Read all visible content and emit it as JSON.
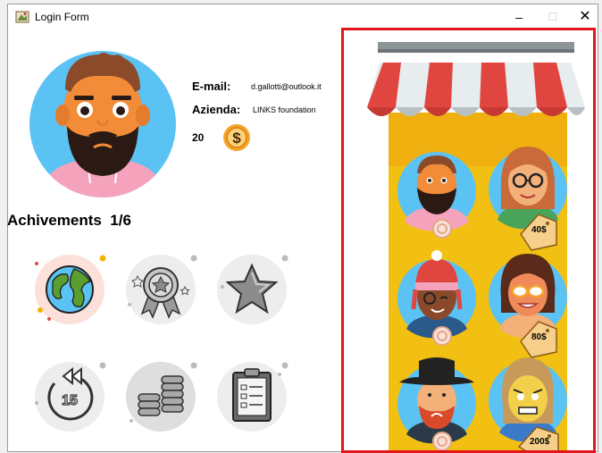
{
  "window": {
    "title": "Login Form",
    "minimize": "–",
    "maximize": "☐",
    "close": "✕"
  },
  "profile": {
    "email_label": "E-mail:",
    "email_value": "d.gallotti@outlook.it",
    "company_label": "Azienda:",
    "company_value": "LINKS foundation",
    "coins": "20",
    "coin_symbol": "$"
  },
  "achievements": {
    "title": "Achivements",
    "progress": "1/6",
    "badges": [
      {
        "icon": "globe-icon",
        "unlocked": true
      },
      {
        "icon": "medal-icon",
        "unlocked": false
      },
      {
        "icon": "star-icon",
        "unlocked": false
      },
      {
        "icon": "rewind-15-icon",
        "unlocked": false
      },
      {
        "icon": "coins-stack-icon",
        "unlocked": false
      },
      {
        "icon": "clipboard-icon",
        "unlocked": false
      }
    ]
  },
  "shop": {
    "avatars": [
      {
        "name": "bearded-man-avatar",
        "price": null,
        "owned": true
      },
      {
        "name": "woman-glasses-avatar",
        "price": "40$"
      },
      {
        "name": "winter-hat-man-avatar",
        "price": null,
        "owned": true
      },
      {
        "name": "woman-orange-glasses-avatar",
        "price": "80$"
      },
      {
        "name": "hat-red-beard-man-avatar",
        "price": null,
        "owned": true
      },
      {
        "name": "angry-woman-avatar",
        "price": "200$"
      }
    ]
  },
  "colors": {
    "shop_border": "#e2151b",
    "shop_column": "#f2c012",
    "awning_red": "#e0463f",
    "avatar_bg": "#5bc2f4",
    "coin": "#f4a52a"
  }
}
